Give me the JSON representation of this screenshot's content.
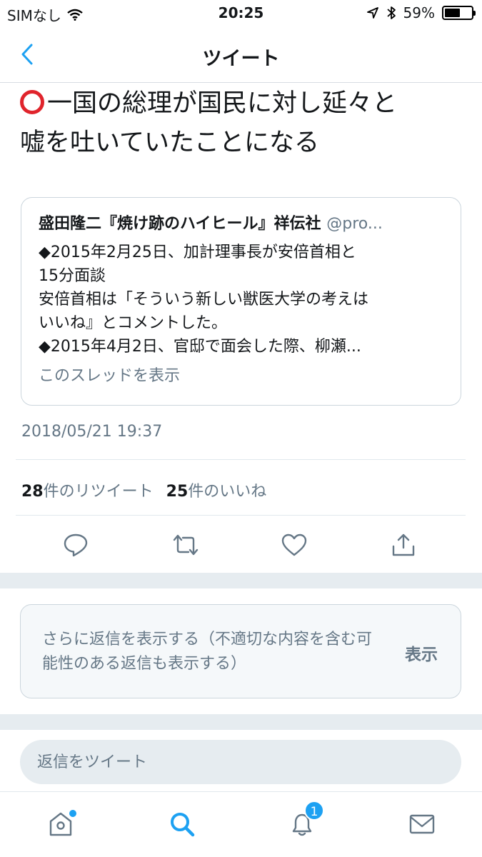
{
  "status_bar": {
    "carrier": "SIMなし",
    "time": "20:25",
    "battery_text": "59%",
    "battery_level": 0.59
  },
  "nav": {
    "title": "ツイート"
  },
  "tweet": {
    "text_line1": "一国の総理が国民に対し延々と",
    "text_line2": "嘘を吐いていたことになる",
    "quote": {
      "author": "盛田隆二『焼け跡のハイヒール』祥伝社",
      "handle": "@pro...",
      "lines": [
        "◆2015年2月25日、加計理事長が安倍首相と",
        "15分面談",
        "安倍首相は「そういう新しい獣医大学の考えは",
        "いいね』とコメントした。",
        "◆2015年4月2日、官邸で面会した際、柳瀬..."
      ],
      "thread_link": "このスレッドを表示"
    },
    "timestamp": "2018/05/21 19:37",
    "retweet_count": "28",
    "retweet_label": "件のリツイート",
    "like_count": "25",
    "like_label": "件のいいね"
  },
  "more_replies": {
    "text": "さらに返信を表示する（不適切な内容を含む可能性のある返信も表示する）",
    "button": "表示"
  },
  "reply": {
    "placeholder": "返信をツイート"
  },
  "tab_bar": {
    "notification_count": "1"
  },
  "colors": {
    "accent": "#1da1f2",
    "circle_mark": "#e0242c",
    "secondary_text": "#657786"
  }
}
